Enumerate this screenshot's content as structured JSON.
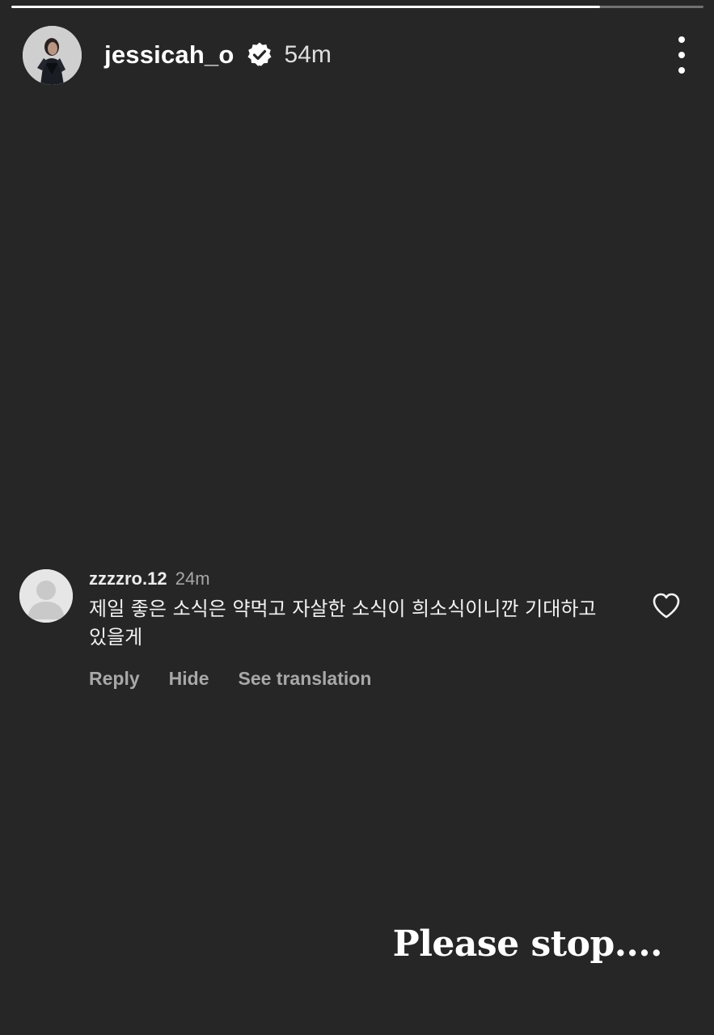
{
  "story": {
    "progress": 0.85,
    "username": "jessicah_o",
    "verified": true,
    "time": "54m",
    "more_icon": "more-vertical-icon",
    "caption": "Please stop...."
  },
  "comment": {
    "username": "zzzzro.12",
    "time": "24m",
    "text": "제일 좋은 소식은 약먹고 자살한 소식이 희소식이니깐 기대하고 있을게",
    "actions": {
      "reply": "Reply",
      "hide": "Hide",
      "translate": "See translation"
    },
    "like_icon": "heart-outline-icon"
  },
  "colors": {
    "background": "#262626",
    "text": "#ffffff",
    "muted": "#a8a8a8"
  }
}
